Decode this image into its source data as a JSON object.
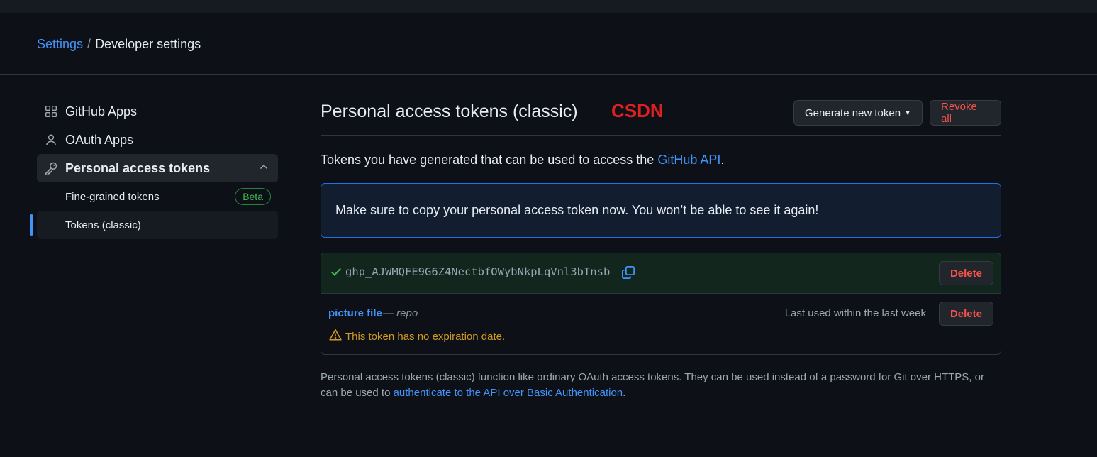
{
  "breadcrumb": {
    "root": "Settings",
    "separator": "/",
    "current": "Developer settings"
  },
  "sidebar": {
    "items": [
      {
        "label": "GitHub Apps",
        "icon": "apps-icon"
      },
      {
        "label": "OAuth Apps",
        "icon": "person-icon"
      },
      {
        "label": "Personal access tokens",
        "icon": "key-icon"
      }
    ],
    "subitems": [
      {
        "label": "Fine-grained tokens",
        "badge": "Beta"
      },
      {
        "label": "Tokens (classic)"
      }
    ]
  },
  "main": {
    "title": "Personal access tokens (classic)",
    "watermark": "CSDN",
    "generate_button": "Generate new token",
    "revoke_button": "Revoke all",
    "intro_text": "Tokens you have generated that can be used to access the ",
    "intro_link": "GitHub API",
    "intro_end": ".",
    "flash": "Make sure to copy your personal access token now. You won’t be able to see it again!",
    "new_token": {
      "value": "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",
      "delete": "Delete"
    },
    "token": {
      "name": "picture file",
      "dash": "—",
      "scope": "repo",
      "last_used": "Last used within the last week",
      "delete": "Delete",
      "warning": "This token has no expiration date."
    },
    "footer": {
      "text": "Personal access tokens (classic) function like ordinary OAuth access tokens. They can be used instead of a password for Git over HTTPS, or can be used to ",
      "link": "authenticate to the API over Basic Authentication",
      "end": "."
    }
  },
  "colors": {
    "accent": "#4493f8",
    "danger": "#f85149",
    "success": "#3fb950",
    "warning": "#d29922",
    "background": "#0d1117"
  }
}
